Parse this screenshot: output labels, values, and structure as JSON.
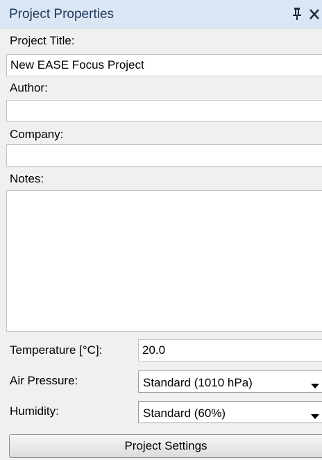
{
  "panel": {
    "title": "Project Properties",
    "pin_icon": "pin-icon",
    "close_icon": "close-icon"
  },
  "fields": {
    "project_title_label": "Project Title:",
    "project_title_value": "New EASE Focus Project",
    "author_label": "Author:",
    "author_value": "",
    "company_label": "Company:",
    "company_value": "",
    "notes_label": "Notes:",
    "notes_value": ""
  },
  "environment": {
    "temperature_label": "Temperature [°C]:",
    "temperature_value": "20.0",
    "air_pressure_label": "Air Pressure:",
    "air_pressure_selected": "Standard (1010 hPa)",
    "humidity_label": "Humidity:",
    "humidity_selected": "Standard (60%)",
    "dropdown_icon": "chevron-down-icon"
  },
  "actions": {
    "project_settings_label": "Project Settings"
  },
  "colors": {
    "title_bar": "#dbe6f4",
    "title_text": "#1e395b",
    "panel_background": "#f0f0f0"
  }
}
